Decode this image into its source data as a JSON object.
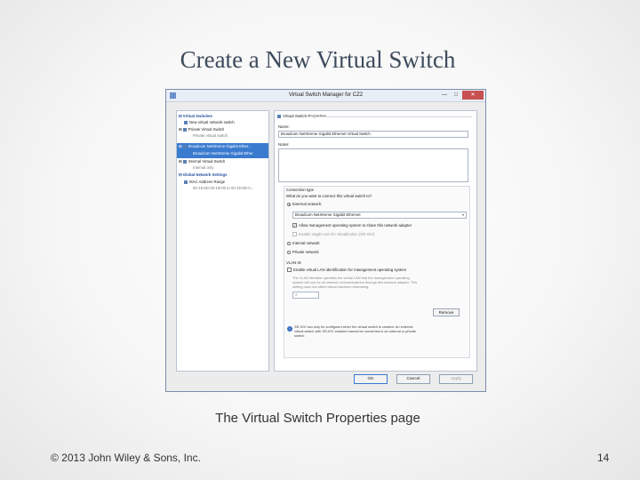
{
  "slide": {
    "title": "Create a New Virtual Switch",
    "caption": "The Virtual Switch Properties page",
    "copyright": "© 2013 John Wiley & Sons, Inc.",
    "page_number": "14"
  },
  "window": {
    "title": "Virtual Switch Manager for CZ2",
    "controls": {
      "minimize": "—",
      "maximize": "□",
      "close": "✕"
    }
  },
  "tree": {
    "section_switches": "Virtual Switches",
    "new_switch": "New virtual network switch",
    "private_switch": "Private Virtual Switch",
    "private_switch_sub": "Private virtual switch",
    "broadcom_switch": "Broadcom NetXtreme Gigabit Ether...",
    "broadcom_switch_sub": "Broadcom NetXtreme Gigabit Ether",
    "internal_switch": "Internal Virtual Switch",
    "internal_switch_sub": "Internal only",
    "section_global": "Global Network Settings",
    "mac_range": "MAC Address Range",
    "mac_range_sub": "00-15-5D-00-1B-00 to 00-15-5D-0..."
  },
  "properties": {
    "header": "Virtual Switch Properties",
    "name_label": "Name:",
    "name_value": "Broadcom NetXtreme Gigabit Ethernet Virtual Switch",
    "notes_label": "Notes:",
    "connection_type_label": "Connection type",
    "connection_question": "What do you want to connect this virtual switch to?",
    "external_network": "External network:",
    "adapter_value": "Broadcom NetXtreme Gigabit Ethernet",
    "allow_mgmt": "Allow management operating system to share this network adapter",
    "enable_sriov": "Enable single-root I/O virtualization (SR-IOV)",
    "internal_network": "Internal network",
    "private_network": "Private network",
    "vlan_label": "VLAN ID",
    "enable_vlan": "Enable virtual LAN identification for management operating system",
    "vlan_desc_1": "The VLAN identifier specifies the virtual LAN that the management operating",
    "vlan_desc_2": "system will use for all network communications through this network adapter. This",
    "vlan_desc_3": "setting does not affect virtual machine networking.",
    "vlan_value": "2",
    "remove_button": "Remove",
    "sriov_note_1": "SR-IOV can only be configured when the virtual switch is created. An external",
    "sriov_note_2": "virtual switch with SR-IOV enabled cannot be converted to an internal or private",
    "sriov_note_3": "switch."
  },
  "buttons": {
    "ok": "OK",
    "cancel": "Cancel",
    "apply": "Apply"
  }
}
